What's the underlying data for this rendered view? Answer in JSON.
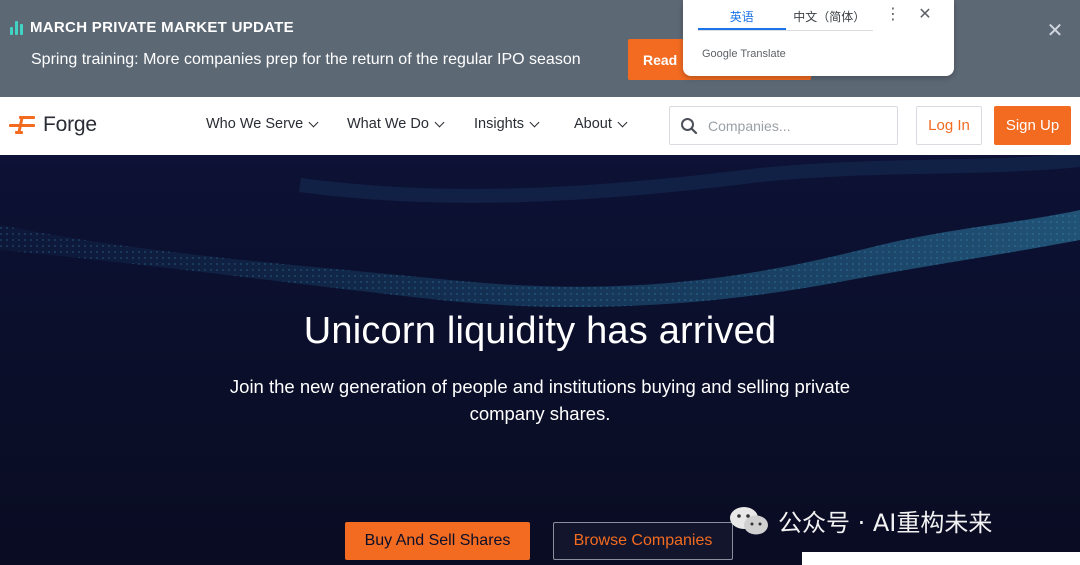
{
  "banner": {
    "title": "MARCH PRIVATE MARKET UPDATE",
    "text": "Spring training: More companies prep for the return of the regular IPO season",
    "read_label": "Read",
    "close_icon": "close-icon",
    "accent": "#41d3c3"
  },
  "translate_popup": {
    "tabs": [
      {
        "label": "英语",
        "active": true
      },
      {
        "label": "中文（简体）",
        "active": false
      }
    ],
    "brand": "Google Translate"
  },
  "nav": {
    "logo_text": "Forge",
    "items": [
      {
        "label": "Who We Serve"
      },
      {
        "label": "What We Do"
      },
      {
        "label": "Insights"
      },
      {
        "label": "About"
      }
    ],
    "search_placeholder": "Companies...",
    "login_label": "Log In",
    "signup_label": "Sign Up"
  },
  "hero": {
    "title": "Unicorn liquidity has arrived",
    "subtitle": "Join the new generation of people and institutions buying and selling private company shares.",
    "primary_button": "Buy And Sell Shares",
    "secondary_button": "Browse Companies"
  },
  "watermark": {
    "text": "公众号 · AI重构未来"
  },
  "colors": {
    "brand_orange": "#f26b21",
    "hero_bg": "#0b0f2a",
    "banner_bg": "#5d6875"
  }
}
